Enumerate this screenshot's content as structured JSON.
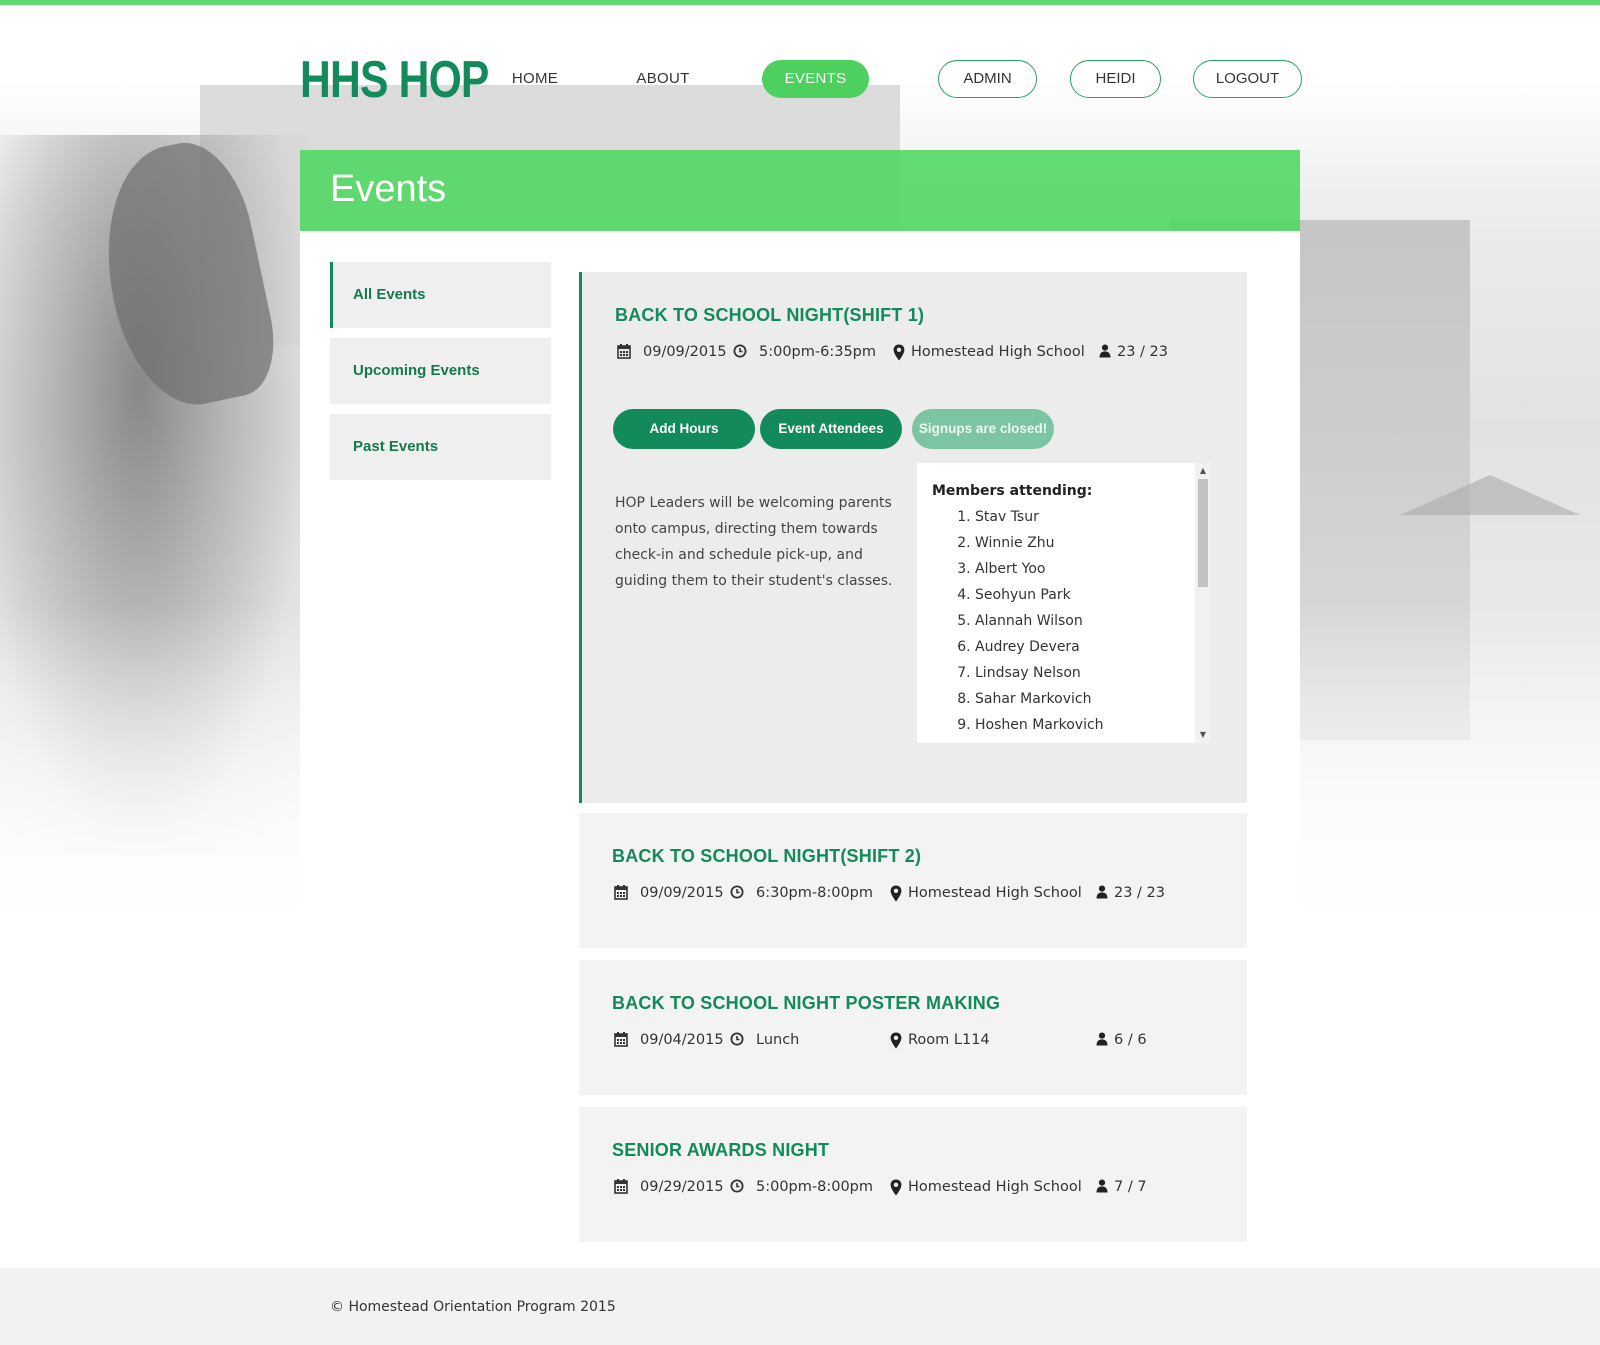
{
  "site": {
    "logo": "HHS HOP"
  },
  "nav": {
    "home": "HOME",
    "about": "ABOUT",
    "events": "EVENTS",
    "admin": "ADMIN",
    "user": "HEIDI",
    "logout": "LOGOUT"
  },
  "page": {
    "title": "Events"
  },
  "sidebar": {
    "items": [
      {
        "label": "All Events",
        "active": true
      },
      {
        "label": "Upcoming Events",
        "active": false
      },
      {
        "label": "Past Events",
        "active": false
      }
    ]
  },
  "events": [
    {
      "title": "BACK TO SCHOOL NIGHT(SHIFT 1)",
      "date": "09/09/2015",
      "time": "5:00pm-6:35pm",
      "location": "Homestead High School",
      "capacity": "23 / 23",
      "buttons": {
        "add_hours": "Add Hours",
        "attendees": "Event Attendees",
        "signup_status": "Signups are closed!"
      },
      "description": "HOP Leaders will be welcoming parents onto campus, directing them towards check-in and schedule pick-up, and guiding them to their student's classes.",
      "members_header": "Members attending:",
      "members": [
        "Stav Tsur",
        "Winnie Zhu",
        "Albert Yoo",
        "Seohyun Park",
        "Alannah Wilson",
        "Audrey Devera",
        "Lindsay Nelson",
        "Sahar Markovich",
        "Hoshen Markovich"
      ]
    },
    {
      "title": "BACK TO SCHOOL NIGHT(SHIFT 2)",
      "date": "09/09/2015",
      "time": "6:30pm-8:00pm",
      "location": "Homestead High School",
      "capacity": "23 / 23"
    },
    {
      "title": "BACK TO SCHOOL NIGHT POSTER MAKING",
      "date": "09/04/2015",
      "time": "Lunch",
      "location": "Room L114",
      "capacity": "6 / 6"
    },
    {
      "title": "SENIOR AWARDS NIGHT",
      "date": "09/29/2015",
      "time": "5:00pm-8:00pm",
      "location": "Homestead High School",
      "capacity": "7 / 7"
    }
  ],
  "footer": {
    "text": "© Homestead Orientation Program 2015"
  },
  "colors": {
    "accent": "#4dd05e",
    "brand": "#128a5a",
    "muted_button": "#7cc5a3"
  },
  "icons": {
    "date": "calendar-icon",
    "time": "clock-icon",
    "location": "map-pin-icon",
    "capacity": "person-icon"
  }
}
